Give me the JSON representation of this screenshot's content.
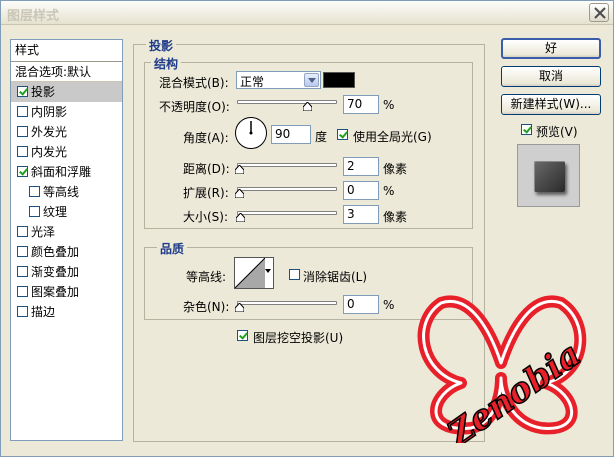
{
  "window": {
    "title": "图层样式"
  },
  "styles_list": {
    "header": "样式",
    "blend_options": "混合选项:默认",
    "items": [
      {
        "label": "投影",
        "checked": true,
        "indent": false,
        "selected": true
      },
      {
        "label": "内阴影",
        "checked": false,
        "indent": false,
        "selected": false
      },
      {
        "label": "外发光",
        "checked": false,
        "indent": false,
        "selected": false
      },
      {
        "label": "内发光",
        "checked": false,
        "indent": false,
        "selected": false
      },
      {
        "label": "斜面和浮雕",
        "checked": true,
        "indent": false,
        "selected": false
      },
      {
        "label": "等高线",
        "checked": false,
        "indent": true,
        "selected": false
      },
      {
        "label": "纹理",
        "checked": false,
        "indent": true,
        "selected": false
      },
      {
        "label": "光泽",
        "checked": false,
        "indent": false,
        "selected": false
      },
      {
        "label": "颜色叠加",
        "checked": false,
        "indent": false,
        "selected": false
      },
      {
        "label": "渐变叠加",
        "checked": false,
        "indent": false,
        "selected": false
      },
      {
        "label": "图案叠加",
        "checked": false,
        "indent": false,
        "selected": false
      },
      {
        "label": "描边",
        "checked": false,
        "indent": false,
        "selected": false
      }
    ]
  },
  "drop_shadow": {
    "section_title": "投影",
    "structure": {
      "title": "结构",
      "blend_mode_label": "混合模式(B):",
      "blend_mode_value": "正常",
      "shadow_color": "#000000",
      "opacity_label": "不透明度(O):",
      "opacity_value": "70",
      "opacity_unit": "%",
      "opacity_fraction": 0.7,
      "angle_label": "角度(A):",
      "angle_value": "90",
      "angle_unit": "度",
      "global_light_label": "使用全局光(G)",
      "global_light_checked": true,
      "distance_label": "距离(D):",
      "distance_value": "2",
      "distance_unit": "像素",
      "spread_label": "扩展(R):",
      "spread_value": "0",
      "spread_unit": "%",
      "size_label": "大小(S):",
      "size_value": "3",
      "size_unit": "像素"
    },
    "quality": {
      "title": "品质",
      "contour_label": "等高线:",
      "anti_alias_label": "消除锯齿(L)",
      "anti_alias_checked": false,
      "noise_label": "杂色(N):",
      "noise_value": "0",
      "noise_unit": "%"
    },
    "knockout_label": "图层挖空投影(U)",
    "knockout_checked": true
  },
  "buttons": {
    "ok": "好",
    "cancel": "取消",
    "new_style": "新建样式(W)..."
  },
  "preview": {
    "label": "预览(V)",
    "checked": true
  },
  "watermark": {
    "text": "Zenobia",
    "color": "#e8202a"
  }
}
